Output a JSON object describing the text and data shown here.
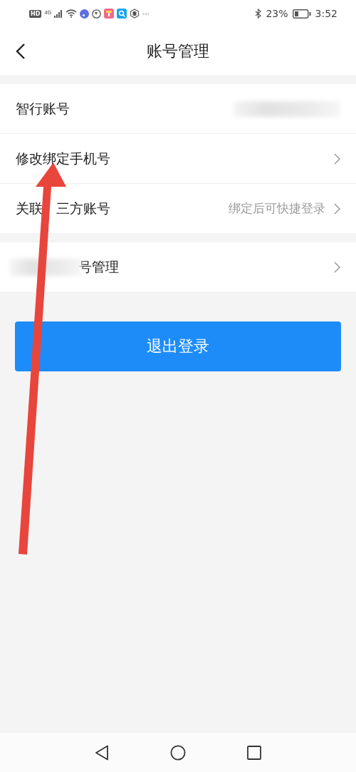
{
  "status_bar": {
    "left_badges": [
      "HD",
      "4G"
    ],
    "battery_text": "23%",
    "time": "3:52",
    "more": "···"
  },
  "header": {
    "title": "账号管理"
  },
  "groups": [
    {
      "rows": [
        {
          "kind": "redacted_value",
          "label": "智行账号"
        },
        {
          "kind": "link",
          "label": "修改绑定手机号"
        },
        {
          "kind": "link_hint",
          "label": "关联",
          "label_rest": "三方账号",
          "hint": "绑定后可快捷登录"
        }
      ]
    },
    {
      "rows": [
        {
          "kind": "redacted_label",
          "label": "号管理"
        }
      ]
    }
  ],
  "logout_button": "退出登录",
  "annotation": {
    "kind": "arrow"
  }
}
